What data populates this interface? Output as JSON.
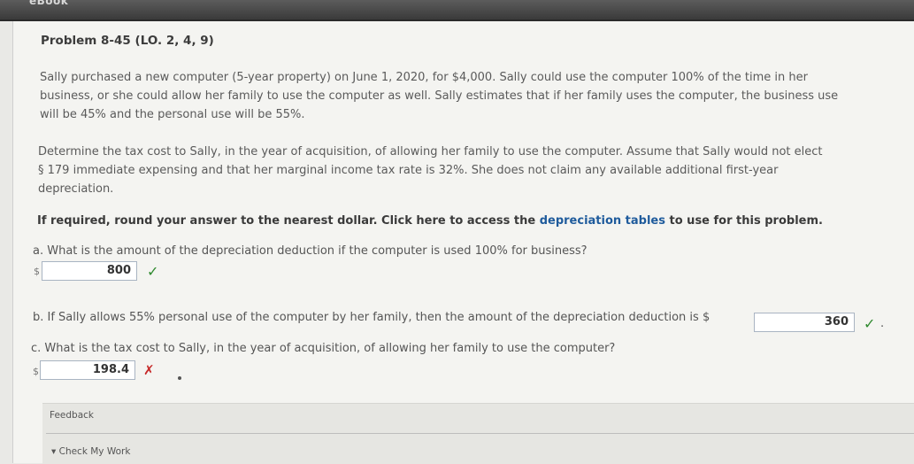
{
  "header": {
    "tab_label": "eBook"
  },
  "problem": {
    "title": "Problem 8-45 (LO. 2, 4, 9)",
    "paragraph1_line1": "Sally purchased a new computer (5-year property) on June 1, 2020, for $4,000. Sally could use the computer 100% of the time in her",
    "paragraph1_line2": "business, or she could allow her family to use the computer as well. Sally estimates that if her family uses the computer, the business use",
    "paragraph1_line3": "will be 45% and the personal use will be 55%.",
    "paragraph2_line1": "Determine the tax cost to Sally, in the year of acquisition, of allowing her family to use the computer. Assume that Sally would not elect",
    "paragraph2_line2": "§ 179 immediate expensing and that her marginal income tax rate is 32%. She does not claim any available additional first-year",
    "paragraph2_line3": "depreciation.",
    "instruction_text": "If required, round your answer to the nearest dollar. Click here to access the",
    "instruction_link": "depreciation tables",
    "instruction_tail": "to use for this problem."
  },
  "questions": {
    "a": {
      "text": "a. What is the amount of the depreciation deduction if the computer is used 100% for business?",
      "currency": "$",
      "answer": "800",
      "status": "✓"
    },
    "b": {
      "text": "b. If Sally allows 55% personal use of the computer by her family, then the amount of the depreciation deduction is $",
      "answer": "360",
      "status": "✓",
      "trailing": "."
    },
    "c": {
      "text": "c. What is the tax cost to Sally, in the year of acquisition, of allowing her family to use the computer?",
      "currency": "$",
      "answer": "198.4",
      "status": "✗"
    }
  },
  "feedback": {
    "label": "Feedback",
    "check_my_work": "▾ Check My Work"
  },
  "colors": {
    "correct": "#2f8a2f",
    "incorrect": "#c62828",
    "link": "#1f5b9c"
  }
}
